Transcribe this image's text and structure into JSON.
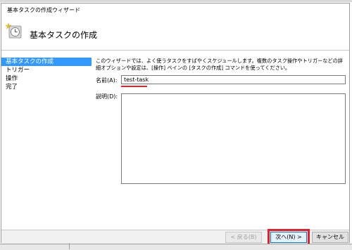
{
  "window": {
    "title": "基本タスクの作成ウィザード",
    "header_title": "基本タスクの作成"
  },
  "steps": [
    {
      "label": "基本タスクの作成",
      "active": true
    },
    {
      "label": "トリガー",
      "active": false
    },
    {
      "label": "操作",
      "active": false
    },
    {
      "label": "完了",
      "active": false
    }
  ],
  "description": "このウィザードでは、よく使うタスクをすばやくスケジュールします。複数のタスク操作やトリガーなどの詳細オプションや設定は、[操作] ペインの [タスクの作成] コマンドを使ってください。",
  "form": {
    "name_label": "名前(A):",
    "name_value": "test-task",
    "description_label": "説明(D):",
    "description_value": ""
  },
  "buttons": {
    "back": "< 戻る(B)",
    "next": "次へ(N) >",
    "cancel": "キャンセル"
  },
  "colors": {
    "highlight": "#e0202a",
    "selection": "#3399ff",
    "focus_border": "#0078d7"
  },
  "icons": {
    "header": "task-scheduler-clock-icon"
  }
}
